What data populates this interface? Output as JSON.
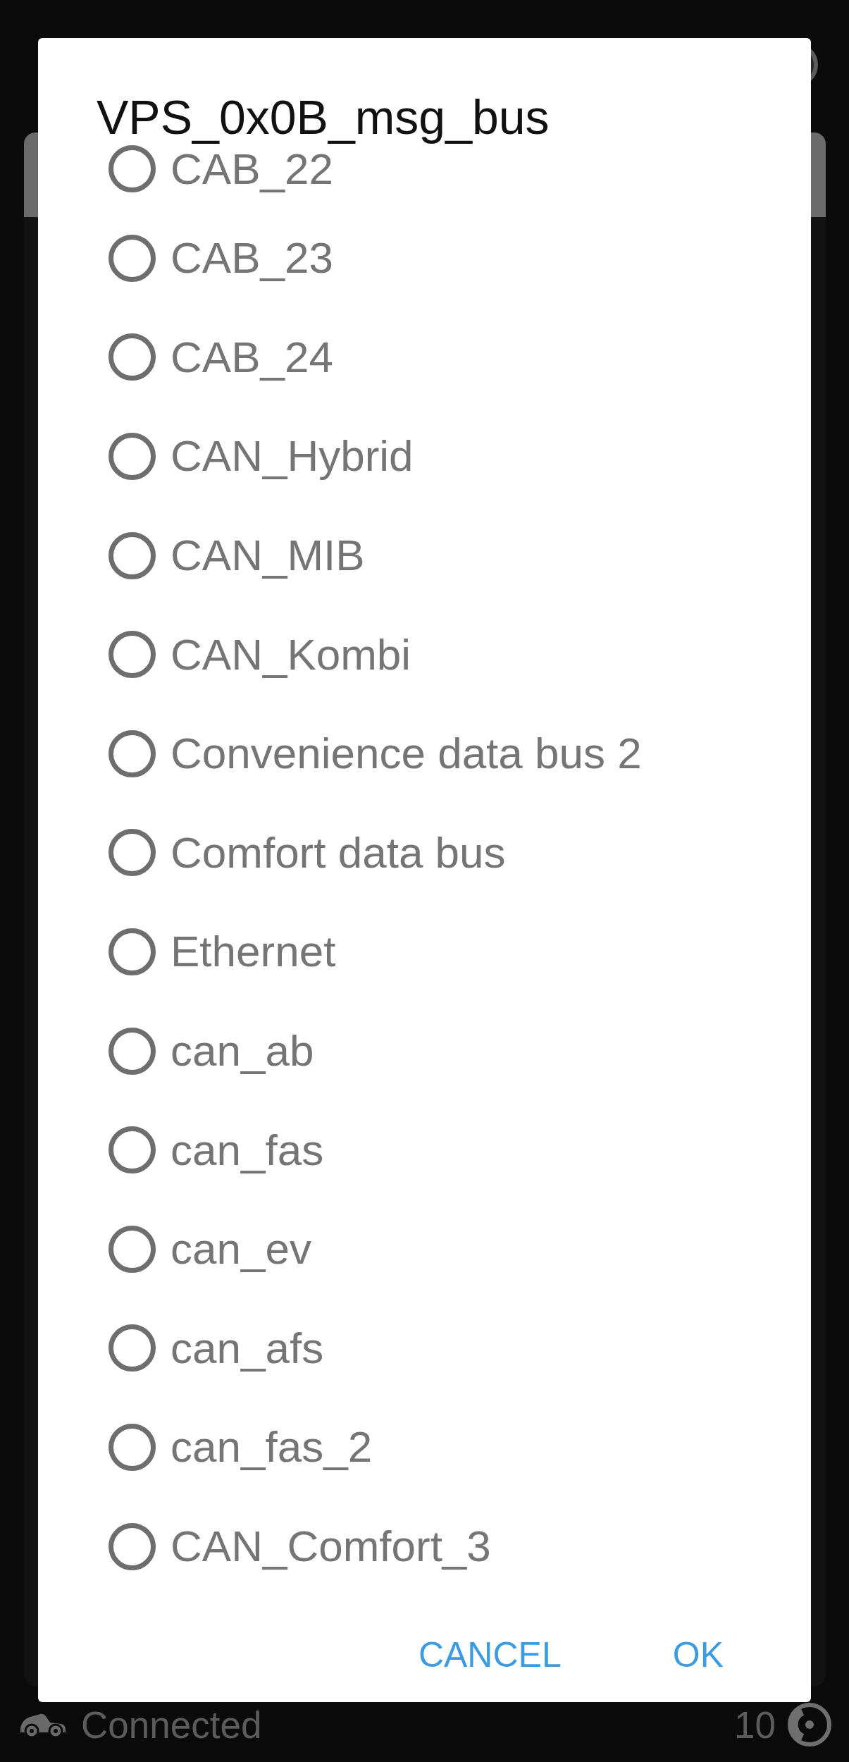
{
  "dialog": {
    "title": "VPS_0x0B_msg_bus",
    "options": [
      {
        "label": "CAB_22",
        "selected": false
      },
      {
        "label": "CAB_23",
        "selected": false
      },
      {
        "label": "CAB_24",
        "selected": false
      },
      {
        "label": "CAN_Hybrid",
        "selected": false
      },
      {
        "label": "CAN_MIB",
        "selected": false
      },
      {
        "label": "CAN_Kombi",
        "selected": false
      },
      {
        "label": "Convenience data bus 2",
        "selected": false
      },
      {
        "label": "Comfort data bus",
        "selected": false
      },
      {
        "label": "Ethernet",
        "selected": false
      },
      {
        "label": "can_ab",
        "selected": false
      },
      {
        "label": "can_fas",
        "selected": false
      },
      {
        "label": "can_ev",
        "selected": false
      },
      {
        "label": "can_afs",
        "selected": false
      },
      {
        "label": "can_fas_2",
        "selected": false
      },
      {
        "label": "CAN_Comfort_3",
        "selected": false
      }
    ],
    "buttons": [
      "CANCEL",
      "OK"
    ]
  },
  "status_bar": {
    "connection": "Connected",
    "count": "10"
  }
}
